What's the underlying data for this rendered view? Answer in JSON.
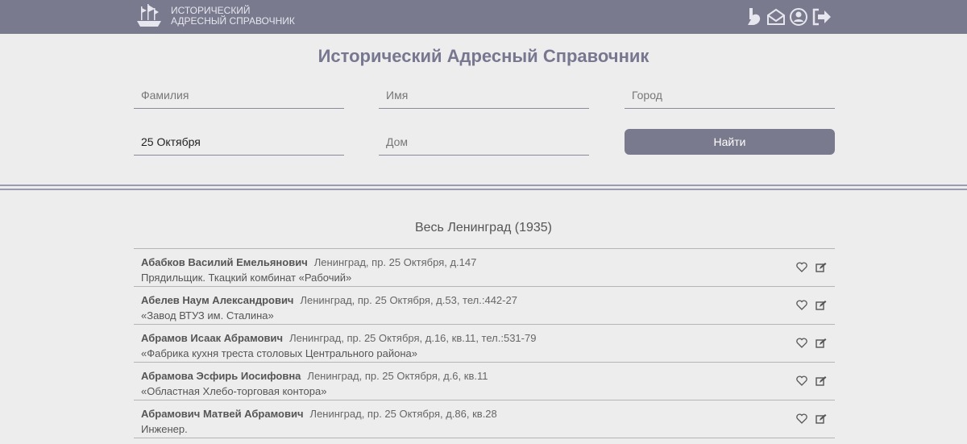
{
  "header": {
    "logo_line1": "Исторический",
    "logo_line2": "Адресный справочник",
    "icons": [
      "b-logo-icon",
      "mail-icon",
      "user-icon",
      "logout-icon"
    ]
  },
  "page_title": "Исторический Адресный Справочник",
  "search": {
    "surname_placeholder": "Фамилия",
    "name_placeholder": "Имя",
    "city_placeholder": "Город",
    "street_value": "25 Октября",
    "house_placeholder": "Дом",
    "find_label": "Найти"
  },
  "section_title": "Весь Ленинград (1935)",
  "results": [
    {
      "name": "Абабков Василий Емельянович",
      "address": "Ленинград, пр. 25 Октября, д.147",
      "job": "Прядильщик. Ткацкий комбинат «Рабочий»"
    },
    {
      "name": "Абелев Наум Александрович",
      "address": "Ленинград, пр. 25 Октября, д.53, тел.:442-27",
      "job": "«Завод ВТУЗ им. Сталина»"
    },
    {
      "name": "Абрамов Исаак Абрамович",
      "address": "Ленинград, пр. 25 Октября, д.16, кв.11, тел.:531-79",
      "job": "«Фабрика кухня треста столовых Центрального района»"
    },
    {
      "name": "Абрамова Эсфирь Иосифовна",
      "address": "Ленинград, пр. 25 Октября, д.6, кв.11",
      "job": "«Областная Хлебо-торговая контора»"
    },
    {
      "name": "Абрамович Матвей Абрамович",
      "address": "Ленинград, пр. 25 Октября, д.86, кв.28",
      "job": "Инженер."
    }
  ]
}
